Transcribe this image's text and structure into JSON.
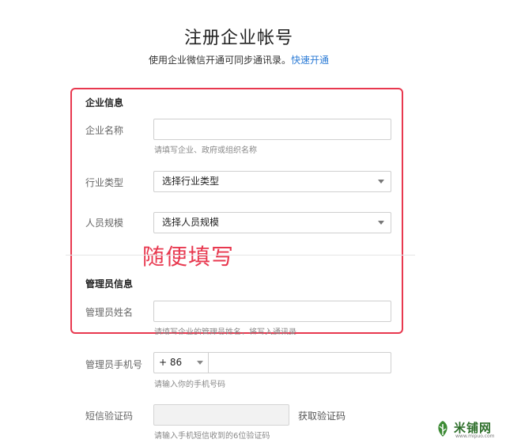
{
  "header": {
    "title": "注册企业帐号",
    "subtitle": "使用企业微信开通可同步通讯录。",
    "quick_link": "快速开通"
  },
  "company_section": {
    "title": "企业信息",
    "name_label": "企业名称",
    "name_value": "",
    "name_hint": "请填写企业、政府或组织名称",
    "industry_label": "行业类型",
    "industry_value": "选择行业类型",
    "size_label": "人员规模",
    "size_value": "选择人员规模"
  },
  "annotation": "随便填写",
  "admin_section": {
    "title": "管理员信息",
    "name_label": "管理员姓名",
    "name_value": "",
    "name_hint": "请填写企业的管理员姓名，将写入通讯录",
    "phone_label": "管理员手机号",
    "phone_code": "+ 86",
    "phone_value": "",
    "phone_hint": "请输入你的手机号码",
    "sms_label": "短信验证码",
    "sms_value": "",
    "sms_button": "获取验证码",
    "sms_hint": "请输入手机短信收到的6位验证码"
  },
  "watermark": {
    "brand": "米铺网",
    "url": "www.mipuo.com"
  },
  "colors": {
    "annotation_red": "#e8384f",
    "link_blue": "#2b7bd6"
  }
}
